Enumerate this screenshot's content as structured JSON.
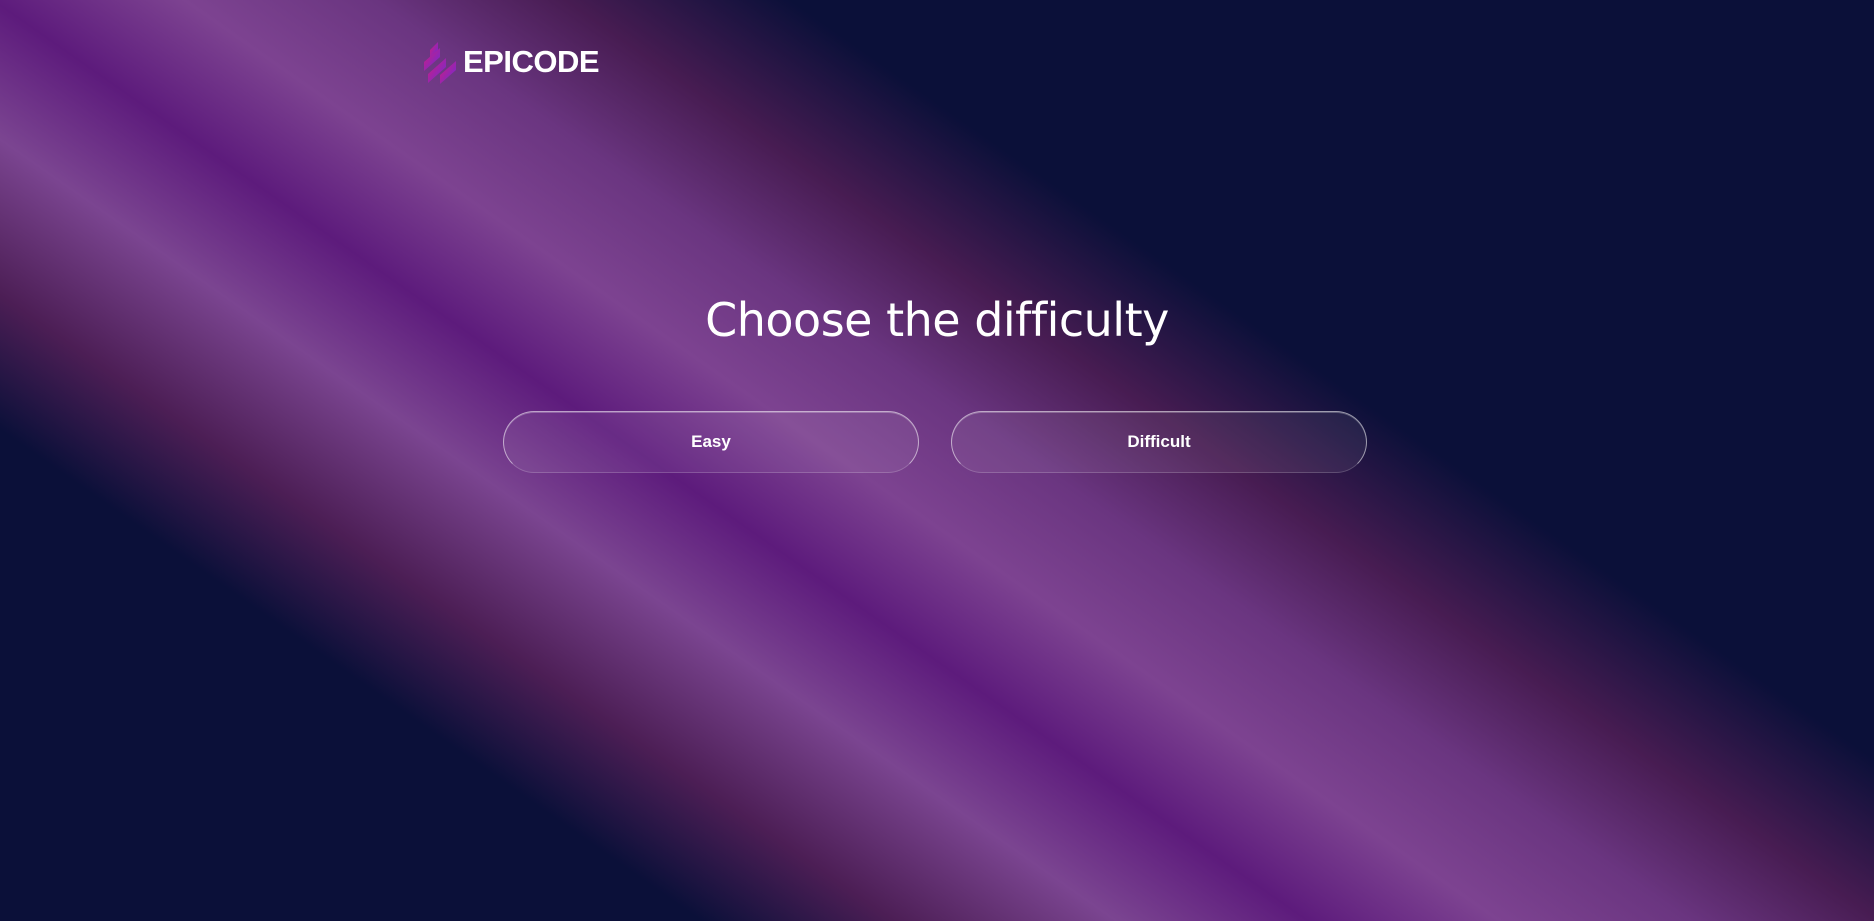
{
  "brand": {
    "name": "EPICODE",
    "logo_icon": "epicode-stripes-logo-icon",
    "accent_colors": [
      "#c3187a",
      "#7a2fd6"
    ]
  },
  "main": {
    "title": "Choose the difficulty",
    "options": [
      {
        "label": "Easy"
      },
      {
        "label": "Difficult"
      }
    ]
  },
  "colors": {
    "background": "#0b1039",
    "stripe_purple": "#7d4391",
    "text": "#ffffff"
  }
}
